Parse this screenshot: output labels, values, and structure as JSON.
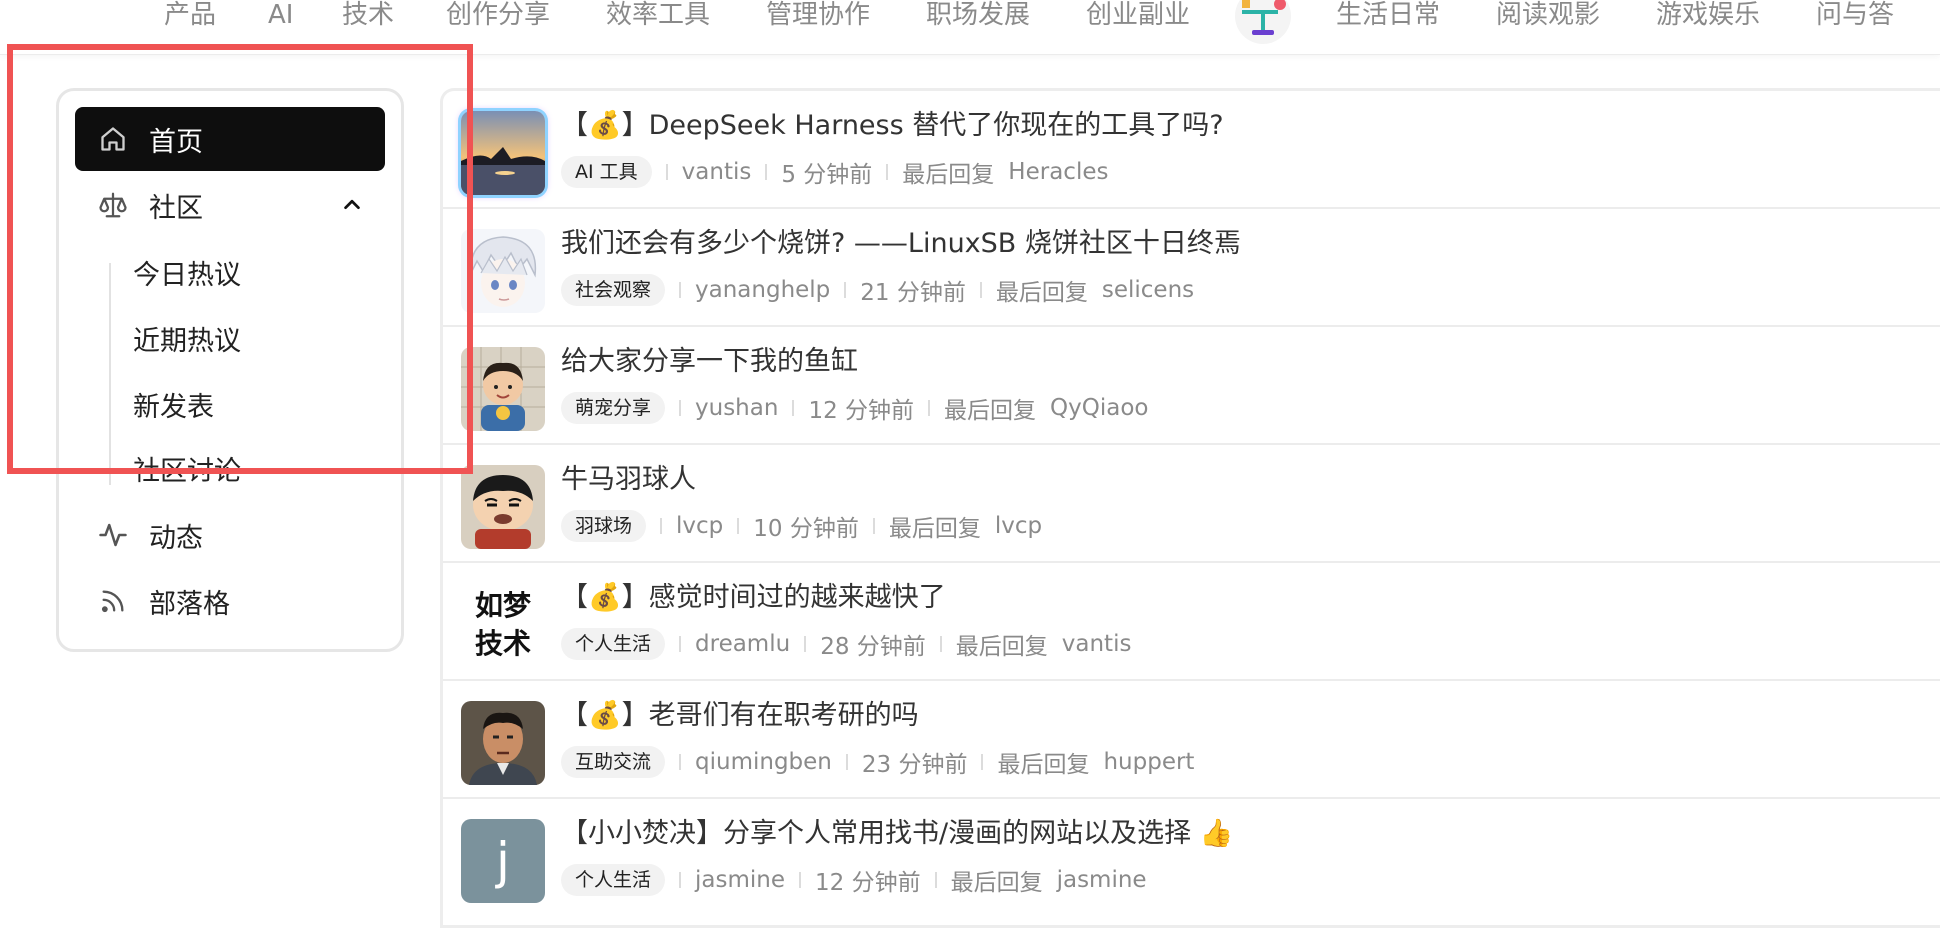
{
  "topnav": {
    "items": [
      "产品",
      "AI",
      "技术",
      "创作分享",
      "效率工具",
      "管理协作",
      "职场发展",
      "创业副业",
      "生活日常",
      "阅读观影",
      "游戏娱乐",
      "问与答"
    ]
  },
  "sidebar": {
    "home": "首页",
    "community": "社区",
    "sub": [
      "今日热议",
      "近期热议",
      "新发表",
      "社区讨论"
    ],
    "activity": "动态",
    "blog": "部落格"
  },
  "feed": [
    {
      "title": "【💰】DeepSeek Harness 替代了你现在的工具了吗?",
      "tag": "AI 工具",
      "author": "vantis",
      "time": "5 分钟前",
      "last_label": "最后回复",
      "last_user": "Heracles",
      "avatar": "sunset-photo"
    },
    {
      "title": "我们还会有多少个烧饼? ——LinuxSB 烧饼社区十日终焉",
      "tag": "社会观察",
      "author": "yananghelp",
      "time": "21 分钟前",
      "last_label": "最后回复",
      "last_user": "selicens",
      "avatar": "anime-boy"
    },
    {
      "title": "给大家分享一下我的鱼缸",
      "tag": "萌宠分享",
      "author": "yushan",
      "time": "12 分钟前",
      "last_label": "最后回复",
      "last_user": "QyQiaoo",
      "avatar": "child-photo"
    },
    {
      "title": "牛马羽球人",
      "tag": "羽球场",
      "author": "lvcp",
      "time": "10 分钟前",
      "last_label": "最后回复",
      "last_user": "lvcp",
      "avatar": "cartoon-boy"
    },
    {
      "title": "【💰】感觉时间过的越来越快了",
      "tag": "个人生活",
      "author": "dreamlu",
      "time": "28 分钟前",
      "last_label": "最后回复",
      "last_user": "vantis",
      "avatar": "text-logo",
      "avatar_text": [
        "如梦",
        "技术"
      ]
    },
    {
      "title": "【💰】老哥们有在职考研的吗",
      "tag": "互助交流",
      "author": "qiumingben",
      "time": "23 分钟前",
      "last_label": "最后回复",
      "last_user": "huppert",
      "avatar": "man-photo"
    },
    {
      "title": "【小小焚决】分享个人常用找书/漫画的网站以及选择 👍",
      "tag": "个人生活",
      "author": "jasmine",
      "time": "12 分钟前",
      "last_label": "最后回复",
      "last_user": "jasmine",
      "avatar": "letter",
      "avatar_letter": "j"
    }
  ],
  "colors": {
    "highlight": "#f05353",
    "active_bg": "#0e0e0e",
    "avatar_letter_bg": "#7b929c"
  }
}
